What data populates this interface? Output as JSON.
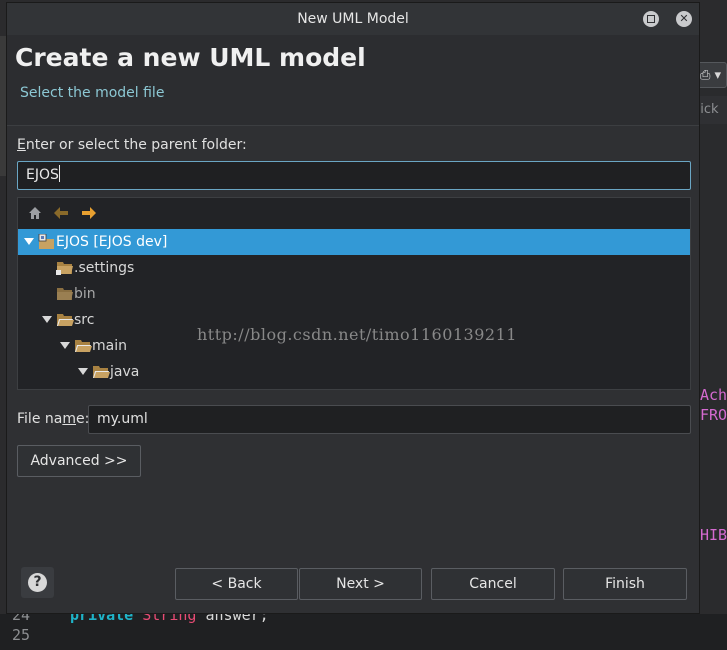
{
  "background": {
    "toolbar_fragment": "⎙ ▾",
    "quick_fragment": "uick",
    "code_right": [
      "Ach",
      "FRO",
      "HIB"
    ],
    "bottom_lines": [
      {
        "num": "24",
        "keyword": "private",
        "type": "String",
        "ident": "answer;"
      },
      {
        "num": "25",
        "keyword": "",
        "type": "",
        "ident": ""
      }
    ]
  },
  "dialog": {
    "window_title": "New UML Model",
    "header": {
      "title": "Create a new UML model",
      "subtitle": "Select the model file"
    },
    "parent_folder": {
      "label_prefix": "",
      "label_mnemonic": "E",
      "label_rest": "nter or select the parent folder:",
      "value": "EJOS"
    },
    "tree": {
      "rows": [
        {
          "label": "EJOS [EJOS dev]",
          "expanded": true,
          "selected": true
        },
        {
          "label": ".settings"
        },
        {
          "label": "bin"
        },
        {
          "label": "src",
          "expanded": true
        },
        {
          "label": "main",
          "expanded": true
        },
        {
          "label": "java",
          "expanded": true
        }
      ]
    },
    "watermark": "http://blog.csdn.net/timo1160139211",
    "file_name": {
      "label_prefix": "File na",
      "label_mnemonic": "m",
      "label_rest": "e:",
      "value": "my.uml"
    },
    "advanced_label": "Advanced >>",
    "buttons": {
      "help": "?",
      "back": "< Back",
      "next": "Next >",
      "cancel": "Cancel",
      "finish": "Finish"
    }
  },
  "colors": {
    "selection": "#3399d6",
    "dialog_bg": "#2f3033",
    "subtitle": "#8cc8d4",
    "focus_border": "#6aa6c4",
    "folder_icon": "#c8a262",
    "arrow_icon": "#e8a030"
  }
}
